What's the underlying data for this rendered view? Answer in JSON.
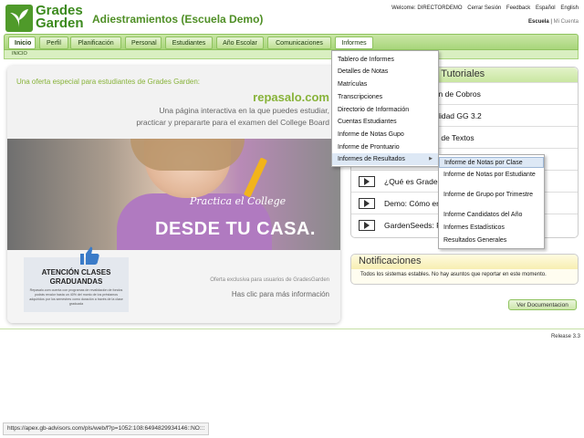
{
  "header": {
    "logo_line1": "Grades",
    "logo_line2": "Garden",
    "school_title": "Adiestramientos (Escuela Demo)",
    "welcome": "Welcome: DIRECTORDEMO",
    "links": [
      "Cerrar Sesión",
      "Feedback",
      "Español",
      "English"
    ],
    "escuela": "Escuela",
    "mi_cuenta": "Mi Cuenta"
  },
  "nav": {
    "items": [
      "Inicio",
      "Perfil",
      "Planificación",
      "Personal",
      "Estudiantes",
      "Año Escolar",
      "Comunicaciones",
      "Informes"
    ],
    "subnav": "INICIO"
  },
  "banner": {
    "offer": "Una oferta especial para estudiantes de Grades Garden:",
    "brand": "repasalo.com",
    "desc1": "Una página interactiva en la que puedes estudiar,",
    "desc2": "practicar y prepararte para el examen del College Board",
    "practica": "Practica el College",
    "desde": "DESDE TU CASA.",
    "atencion1": "ATENCIÓN CLASES",
    "atencion2": "GRADUANDAS",
    "atencion_small": "Repasalo.com cuenta con programas de revalidación de fondos podrás revalor hasta un 40% del monto de los préstamos adquiridos por los semestres como duración a través de la clase graduada",
    "exclusive": "Oferta exclusiva para usuarios de GradesGarden",
    "click_info": "Has clic para más información"
  },
  "videos": {
    "title": "Videos Tutoriales",
    "rows": [
      "Seminario Jardín de Cobros",
      "Nueva funcionalidad GG 3.2",
      "Usar el Sistema de Textos",
      "",
      "¿Qué es Grades",
      "Demo: Cómo en",
      "GardenSeeds: F"
    ]
  },
  "notifications": {
    "title": "Notificaciones",
    "text": "Todos los sistemas estables. No hay asuntos que reportar en este momento."
  },
  "ver_doc": "Ver Documentacion",
  "release": "Release 3.3",
  "status_url": "https://apex.gb-advisors.com/pls/web/f?p=1052:108:6494829934146::NO:::",
  "dropdown": {
    "items": [
      "Tablero de Informes",
      "Detalles de Notas",
      "Matrículas",
      "Transcripciones",
      "Directorio de Información",
      "Cuentas Estudiantes",
      "Informe de Notas Gupo",
      "Informe de Prontuario",
      "Informes de Resultados"
    ],
    "submenu_arrow": "▶"
  },
  "submenu": {
    "items": [
      "Informe de Notas por Clase",
      "Informe de Notas por Estudiante",
      "Informe de Grupo por Trimestre",
      "Informe Candidatos del Año",
      "Informes Estadísticos",
      "Resultados Generales"
    ]
  },
  "colors": {
    "accent_green": "#4f9a2a",
    "nav_green": "#a8d57a",
    "hover_blue": "#dde8f5"
  }
}
